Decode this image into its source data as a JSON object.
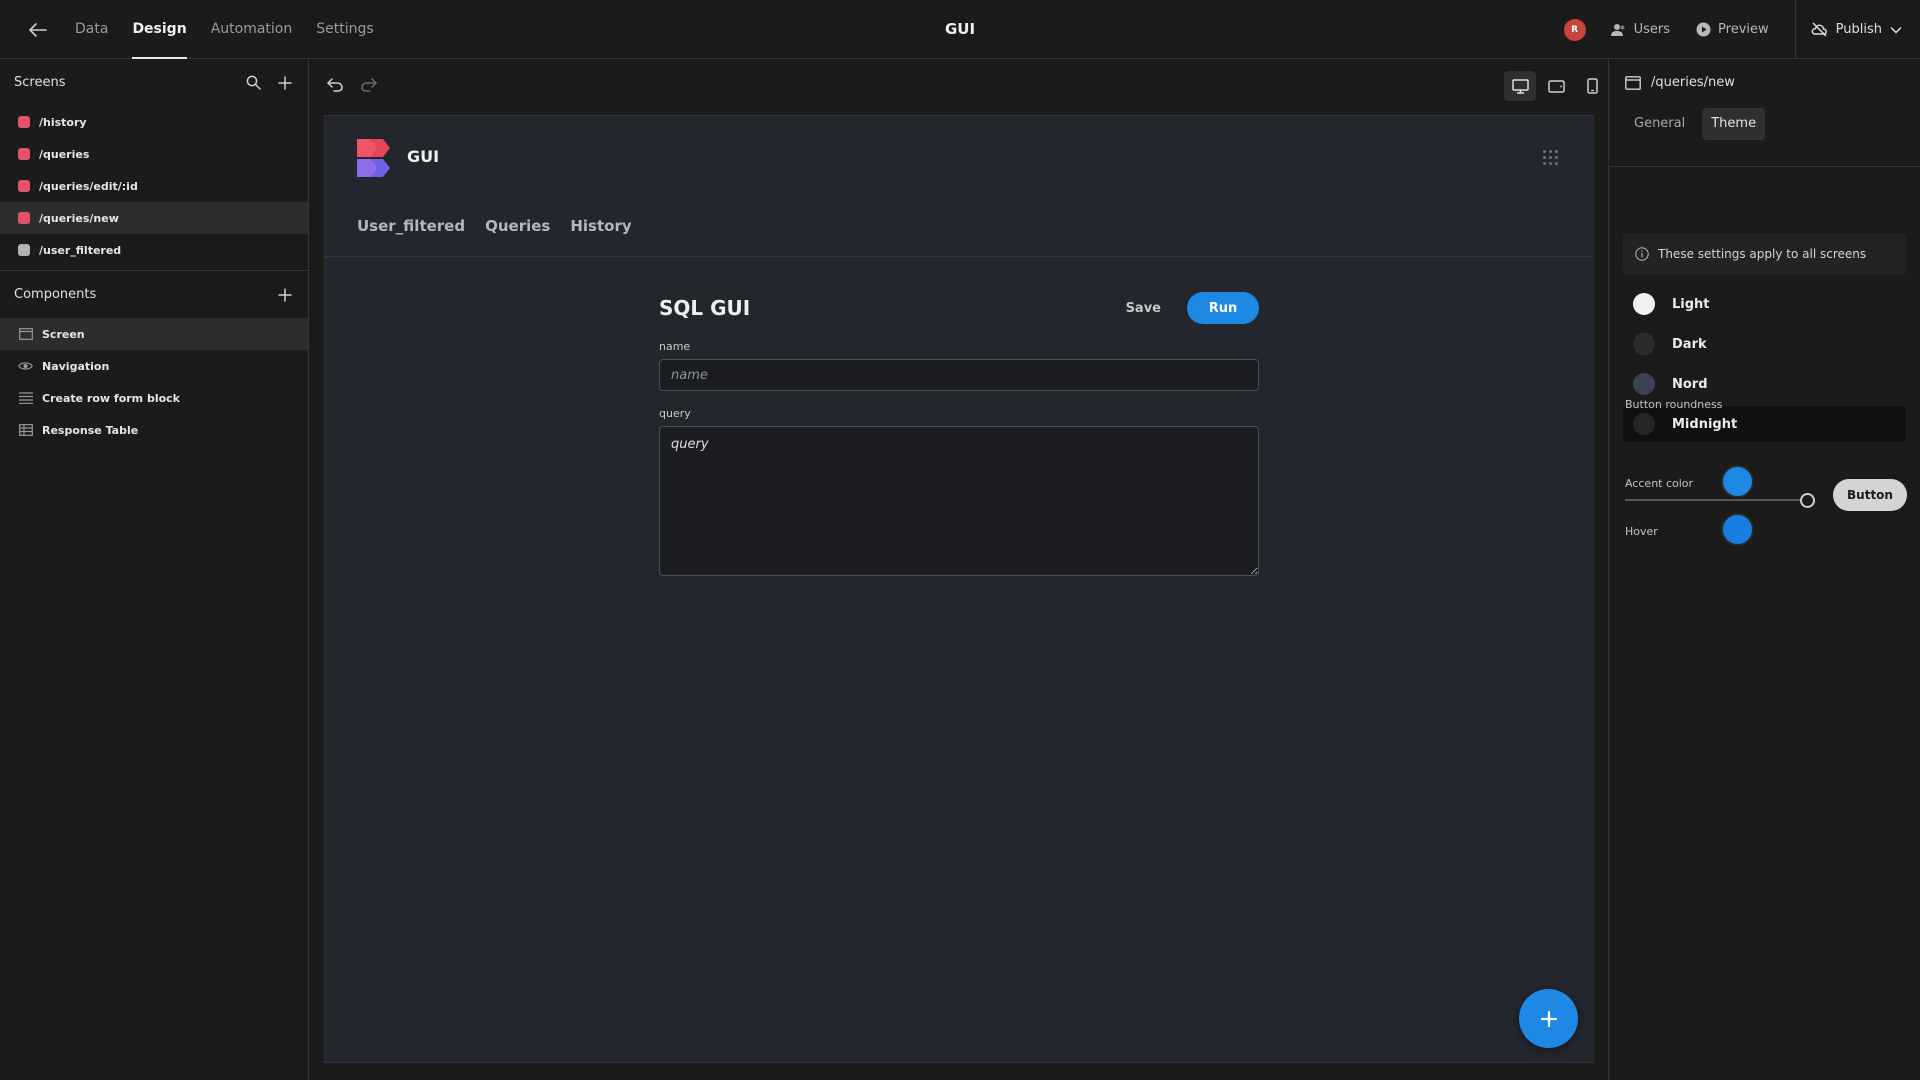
{
  "topbar": {
    "tabs": [
      "Data",
      "Design",
      "Automation",
      "Settings"
    ],
    "active_tab": "Design",
    "title": "GUI",
    "avatar_initial": "R",
    "users_label": "Users",
    "preview_label": "Preview",
    "publish_label": "Publish"
  },
  "screens": {
    "title": "Screens",
    "items": [
      "/history",
      "/queries",
      "/queries/edit/:id",
      "/queries/new",
      "/user_filtered"
    ],
    "selected": "/queries/new"
  },
  "components": {
    "title": "Components",
    "items": [
      "Screen",
      "Navigation",
      "Create row form block",
      "Response Table"
    ],
    "selected": "Screen"
  },
  "app": {
    "name": "GUI",
    "nav_links": [
      "User_filtered",
      "Queries",
      "History"
    ]
  },
  "form": {
    "title": "SQL GUI",
    "save_label": "Save",
    "run_label": "Run",
    "name_label": "name",
    "name_placeholder": "name",
    "query_label": "query",
    "query_placeholder": "query"
  },
  "settings_panel": {
    "path": "/queries/new",
    "tabs": [
      "General",
      "Theme"
    ],
    "active_tab": "Theme",
    "info": "These settings apply to all screens",
    "themes": [
      {
        "name": "Light",
        "color": "#f2f2f2"
      },
      {
        "name": "Dark",
        "color": "#2b2b2b"
      },
      {
        "name": "Nord",
        "color": "#3b4252"
      },
      {
        "name": "Midnight",
        "color": "#262626"
      }
    ],
    "selected_theme": "Midnight",
    "roundness_label": "Button roundness",
    "roundness_value": 1.0,
    "button_preview_label": "Button",
    "accent_label": "Accent color",
    "accent_color": "#1e88e5",
    "hover_label": "Hover",
    "hover_color": "#1a7ee0"
  },
  "colors": {
    "accent": "#1e88e5",
    "screen_marker": "#e15464",
    "screen_marker_inactive": "#b3b3b3"
  }
}
